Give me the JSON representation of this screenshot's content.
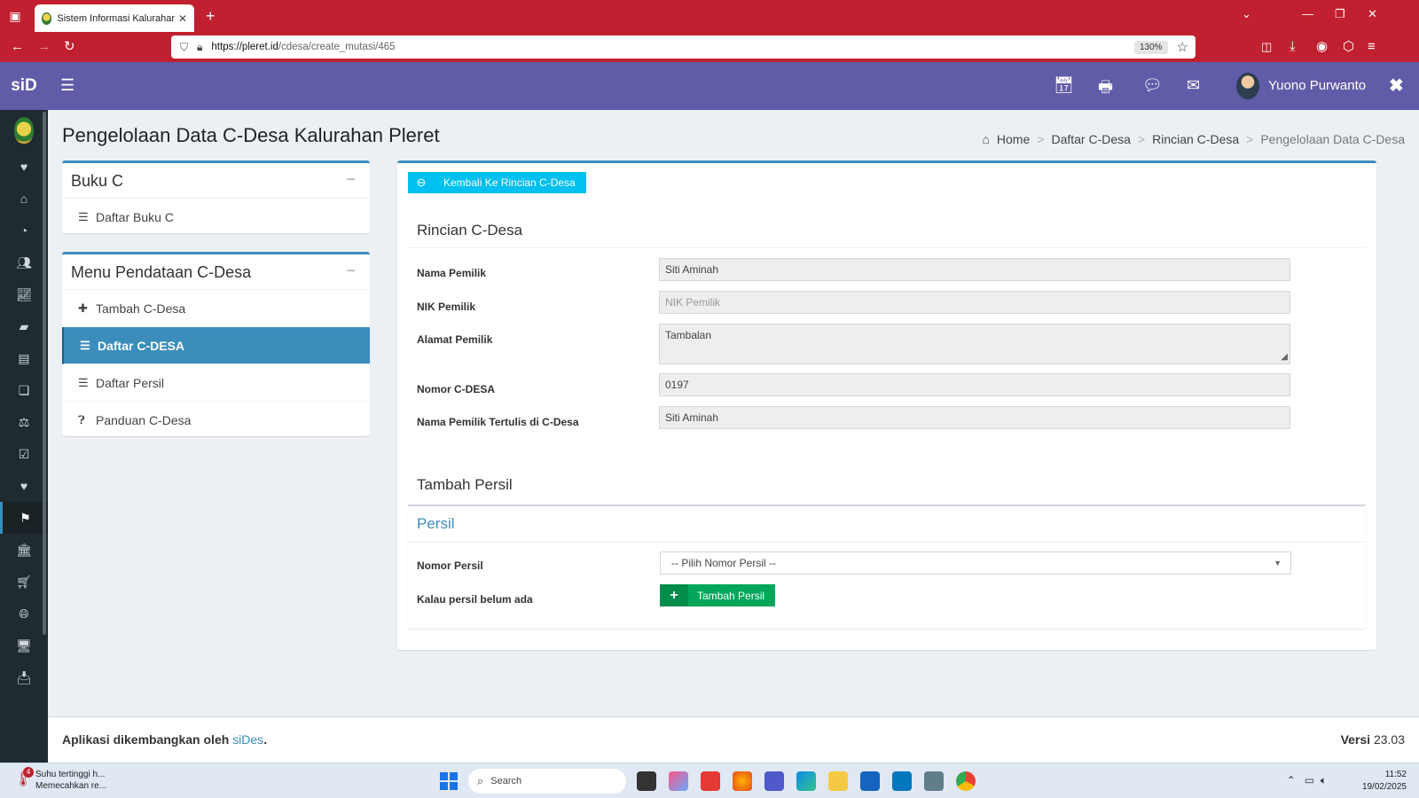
{
  "browser": {
    "tab_title": "Sistem Informasi Kalurahan Pleret",
    "url_host": "https://pleret.id",
    "url_path": "/cdesa/create_mutasi/465",
    "zoom": "130%"
  },
  "app": {
    "brand": "siD",
    "user_name": "Yuono Purwanto"
  },
  "page": {
    "title": "Pengelolaan Data C-Desa Kalurahan Pleret",
    "breadcrumb": [
      "Home",
      "Daftar C-Desa",
      "Rincian C-Desa",
      "Pengelolaan Data C-Desa"
    ]
  },
  "left_boxes": {
    "buku_c": {
      "title": "Buku C",
      "items": [
        {
          "label": "Daftar Buku C",
          "icon": "list-icon"
        }
      ]
    },
    "menu": {
      "title": "Menu Pendataan C-Desa",
      "items": [
        {
          "label": "Tambah C-Desa",
          "icon": "plus-icon"
        },
        {
          "label": "Daftar C-DESA",
          "icon": "list-icon",
          "active": true
        },
        {
          "label": "Daftar Persil",
          "icon": "list-icon"
        },
        {
          "label": "Panduan C-Desa",
          "icon": "question-icon"
        }
      ]
    }
  },
  "main": {
    "back_button": "Kembali Ke Rincian C-Desa",
    "rincian_title": "Rincian C-Desa",
    "fields": {
      "nama_pemilik": {
        "label": "Nama Pemilik",
        "value": "Siti Aminah"
      },
      "nik_pemilik": {
        "label": "NIK Pemilik",
        "placeholder": "NIK Pemilik"
      },
      "alamat_pemilik": {
        "label": "Alamat Pemilik",
        "value": "Tambalan"
      },
      "nomor_cdesa": {
        "label": "Nomor C-DESA",
        "value": "0197"
      },
      "nama_tertulis": {
        "label": "Nama Pemilik Tertulis di C-Desa",
        "value": "Siti Aminah"
      }
    },
    "tambah_persil_title": "Tambah Persil",
    "persil_box_title": "Persil",
    "nomor_persil_label": "Nomor Persil",
    "nomor_persil_select": "-- Pilih Nomor Persil --",
    "belum_ada_label": "Kalau persil belum ada",
    "tambah_persil_button": "Tambah Persil"
  },
  "footer": {
    "text": "Aplikasi dikembangkan oleh",
    "link": "siDes",
    "period": ".",
    "version_label": "Versi",
    "version": "23.03"
  },
  "taskbar": {
    "weather_title": "Suhu tertinggi h...",
    "weather_sub": "Memecahkan re...",
    "weather_badge": "4",
    "search": "Search",
    "time": "11:52",
    "date": "19/02/2025"
  },
  "colors": {
    "browser_red": "#c0202f",
    "header_purple": "#605ca8",
    "sidebar_dark": "#1e2b30",
    "primary": "#3c8dbc",
    "info": "#00c0ef",
    "success": "#00a65a"
  }
}
